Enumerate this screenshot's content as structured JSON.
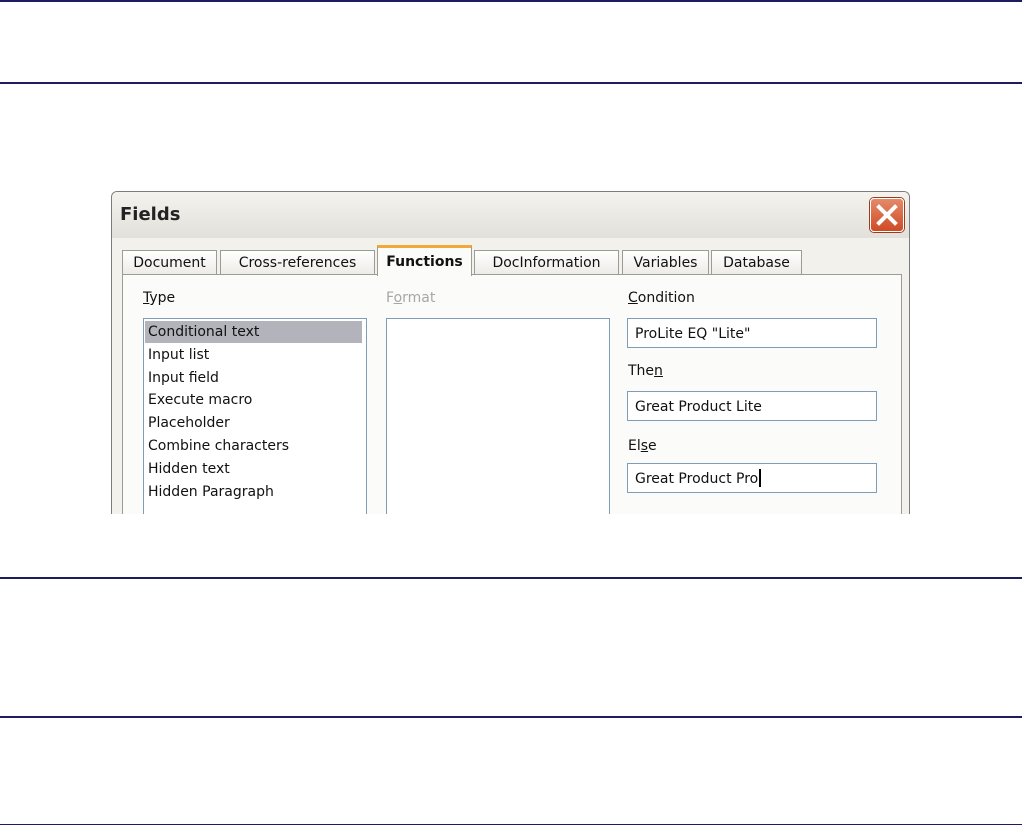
{
  "dialog": {
    "title": "Fields",
    "tabs": [
      {
        "label": "Document",
        "active": false
      },
      {
        "label": "Cross-references",
        "active": false
      },
      {
        "label": "Functions",
        "active": true
      },
      {
        "label": "DocInformation",
        "active": false
      },
      {
        "label": "Variables",
        "active": false
      },
      {
        "label": "Database",
        "active": false
      }
    ],
    "type_label": {
      "underlined": "T",
      "rest": "ype"
    },
    "format_label": {
      "pre": "F",
      "underlined": "o",
      "rest": "rmat"
    },
    "condition_label": {
      "underlined": "C",
      "rest": "ondition"
    },
    "then_label": {
      "pre": "The",
      "underlined": "n",
      "rest": ""
    },
    "else_label": {
      "pre": "El",
      "underlined": "s",
      "rest": "e"
    },
    "type_items": [
      {
        "label": "Conditional text",
        "selected": true
      },
      {
        "label": "Input list",
        "selected": false
      },
      {
        "label": "Input field",
        "selected": false
      },
      {
        "label": "Execute macro",
        "selected": false
      },
      {
        "label": "Placeholder",
        "selected": false
      },
      {
        "label": "Combine characters",
        "selected": false
      },
      {
        "label": "Hidden text",
        "selected": false
      },
      {
        "label": "Hidden Paragraph",
        "selected": false
      }
    ],
    "condition_value": "ProLite EQ \"Lite\"",
    "then_value": "Great Product Lite",
    "else_value": "Great Product Pro"
  },
  "colors": {
    "rule": "#1c1c5e",
    "active_tab_accent": "#f3a939",
    "selection": "#b3b3bc",
    "close_button": "#cf4a24"
  },
  "icons": {
    "close": "close-x-icon"
  }
}
